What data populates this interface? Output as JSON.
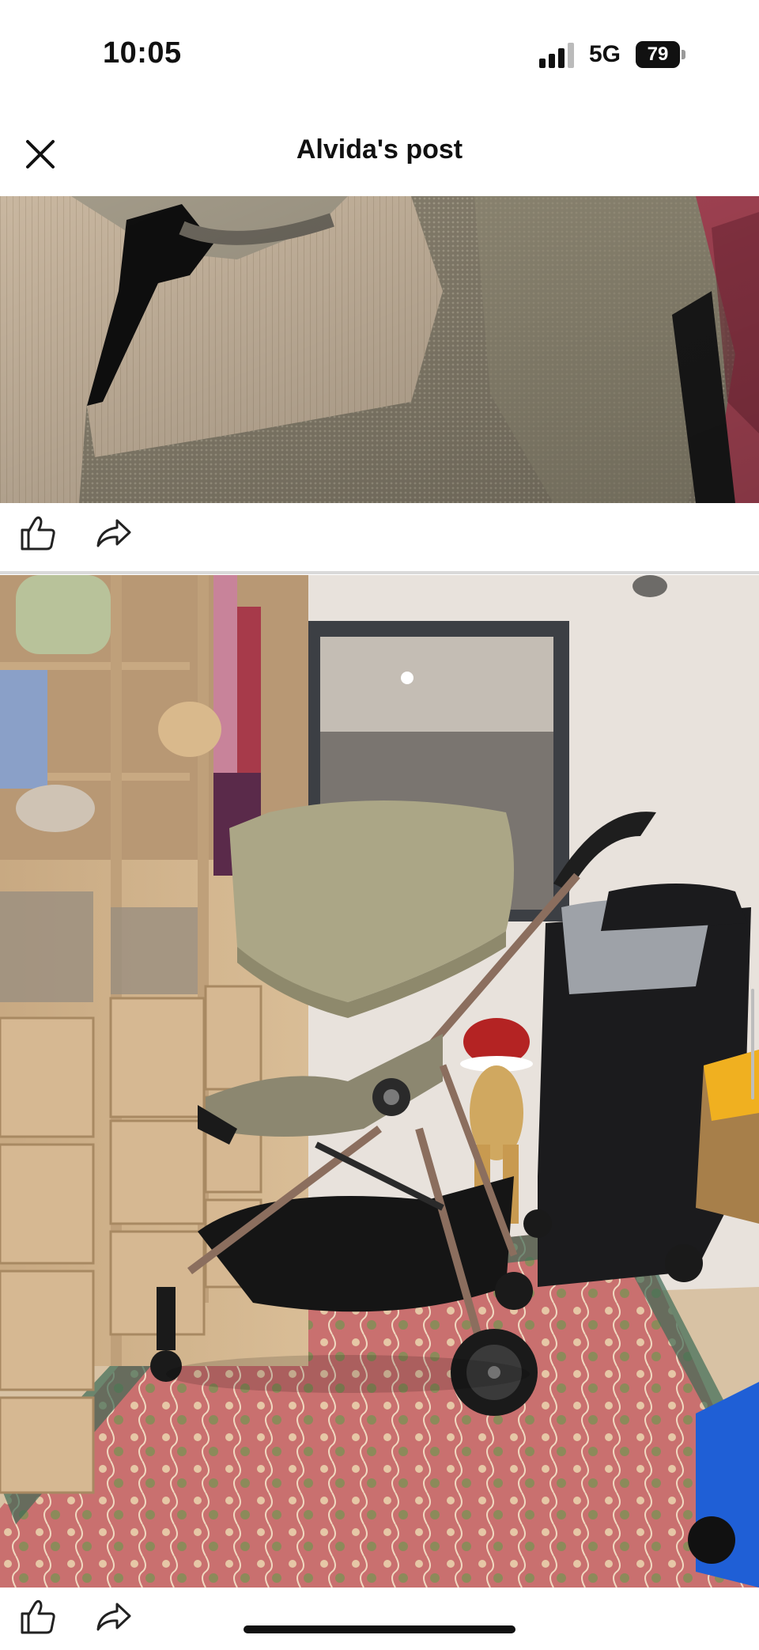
{
  "status_bar": {
    "time": "10:05",
    "network": "5G",
    "battery_level": "79",
    "signal_icon": "cellular-signal-icon",
    "battery_icon": "battery-icon"
  },
  "header": {
    "title": "Alvida's post",
    "close_icon": "close-icon"
  },
  "posts": [
    {
      "image": "photo-stroller-fabric-closeup",
      "actions": {
        "like_icon": "thumbs-up-icon",
        "share_icon": "share-arrow-icon"
      }
    },
    {
      "image": "photo-stroller-in-closet-room",
      "actions": {
        "like_icon": "thumbs-up-icon",
        "share_icon": "share-arrow-icon"
      }
    }
  ],
  "colors": {
    "background": "#ffffff",
    "text": "#111111",
    "divider": "#d9d9d9"
  }
}
